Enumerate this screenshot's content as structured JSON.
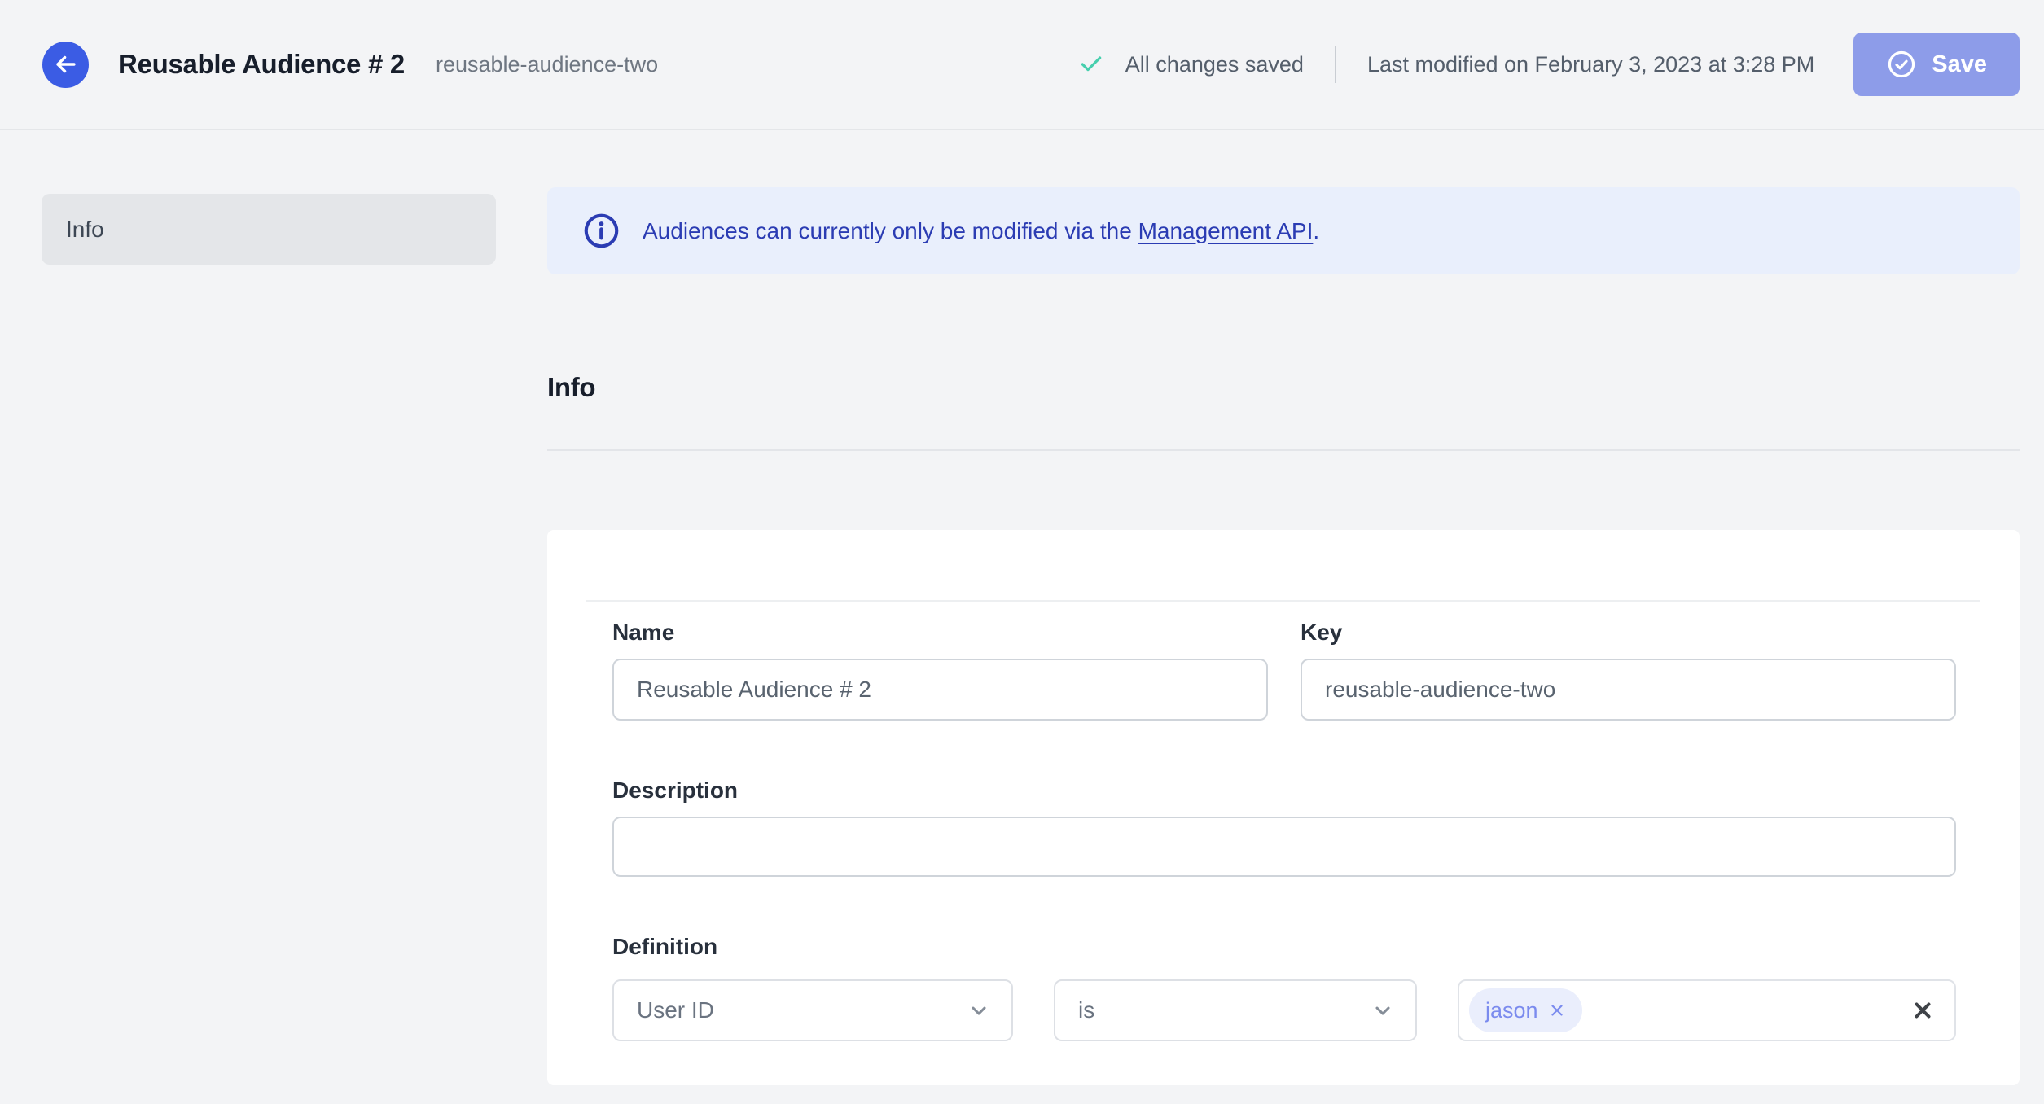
{
  "header": {
    "title": "Reusable Audience # 2",
    "key": "reusable-audience-two",
    "saved_status": "All changes saved",
    "last_modified": "Last modified on February 3, 2023 at 3:28 PM",
    "save_label": "Save"
  },
  "sidebar": {
    "items": [
      {
        "label": "Info",
        "active": true
      }
    ]
  },
  "banner": {
    "text_before_link": "Audiences can currently only be modified via the ",
    "link_text": "Management API",
    "text_after_link": "."
  },
  "section": {
    "title": "Info"
  },
  "form": {
    "name": {
      "label": "Name",
      "value": "Reusable Audience # 2"
    },
    "key": {
      "label": "Key",
      "value": "reusable-audience-two"
    },
    "description": {
      "label": "Description",
      "value": ""
    },
    "definition": {
      "label": "Definition",
      "attribute": {
        "value": "User ID"
      },
      "operator": {
        "value": "is"
      },
      "values": {
        "chips": [
          "jason"
        ]
      }
    }
  },
  "colors": {
    "brand_blue": "#3b5ce4",
    "save_button": "#8d9ce9",
    "success_check": "#47cfae",
    "banner_bg": "#e9effc",
    "banner_text": "#2b3cb3",
    "chip_bg": "#eaeefc",
    "chip_text": "#7b8bee",
    "page_bg": "#f3f4f6"
  }
}
